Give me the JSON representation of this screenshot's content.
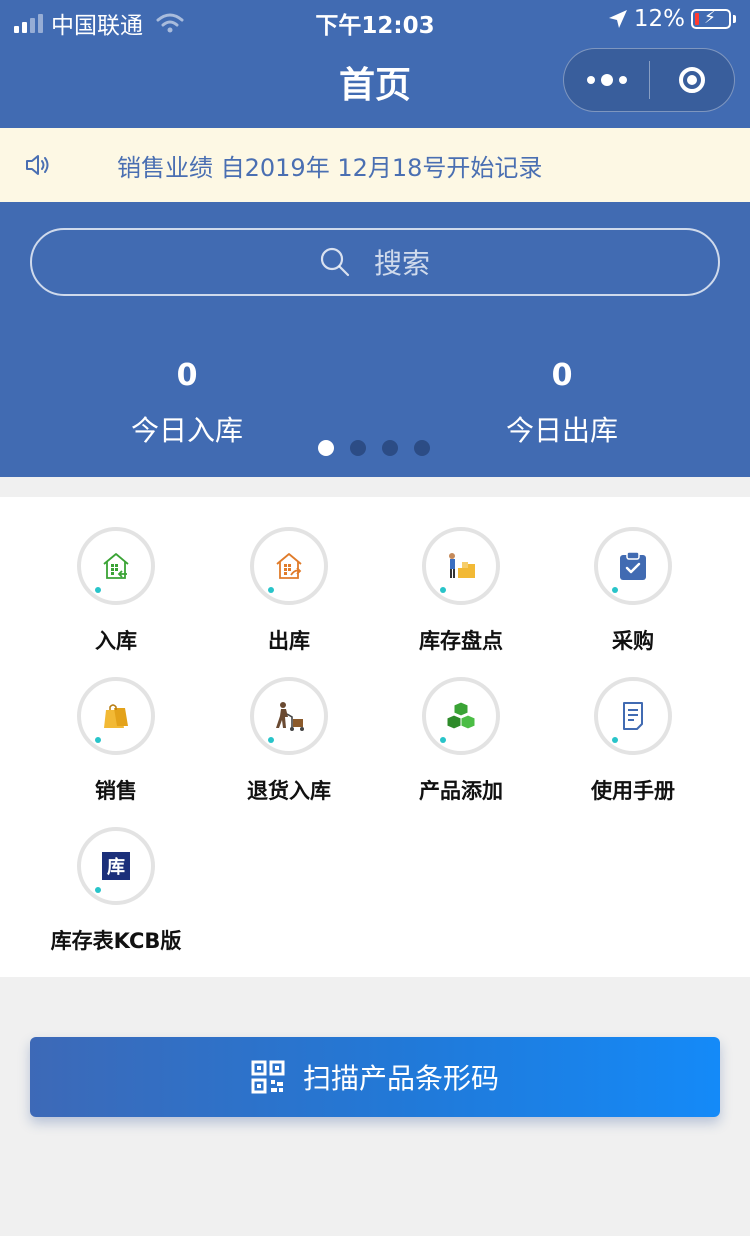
{
  "status_bar": {
    "carrier": "中国联通",
    "time": "下午12:03",
    "battery_percent": "12%",
    "battery_level": 0.12
  },
  "nav": {
    "title": "首页"
  },
  "notice": {
    "text": "销售业绩 自2019年 12月18号开始记录"
  },
  "search": {
    "placeholder": "搜索"
  },
  "stats": [
    {
      "value": "0",
      "label": "今日入库"
    },
    {
      "value": "0",
      "label": "今日出库"
    }
  ],
  "carousel": {
    "page_count": 4,
    "active_index": 0
  },
  "menu": [
    {
      "label": "入库",
      "icon": "warehouse-in-icon"
    },
    {
      "label": "出库",
      "icon": "warehouse-out-icon"
    },
    {
      "label": "库存盘点",
      "icon": "inventory-check-icon"
    },
    {
      "label": "采购",
      "icon": "clipboard-check-icon"
    },
    {
      "label": "销售",
      "icon": "shopping-bag-icon"
    },
    {
      "label": "退货入库",
      "icon": "hand-truck-icon"
    },
    {
      "label": "产品添加",
      "icon": "boxes-icon"
    },
    {
      "label": "使用手册",
      "icon": "document-icon"
    },
    {
      "label": "库存表KCB版",
      "icon": "kcb-logo-icon",
      "logo_text": "库"
    }
  ],
  "scan_button": {
    "label": "扫描产品条形码",
    "icon": "qr-code-icon"
  },
  "colors": {
    "primary": "#416bb2",
    "notice_bg": "#fdf8e4",
    "notice_text": "#4a6fb2",
    "green": "#3aa335",
    "orange": "#e07b2a",
    "gold": "#f2b935",
    "button_end": "#148af8"
  }
}
